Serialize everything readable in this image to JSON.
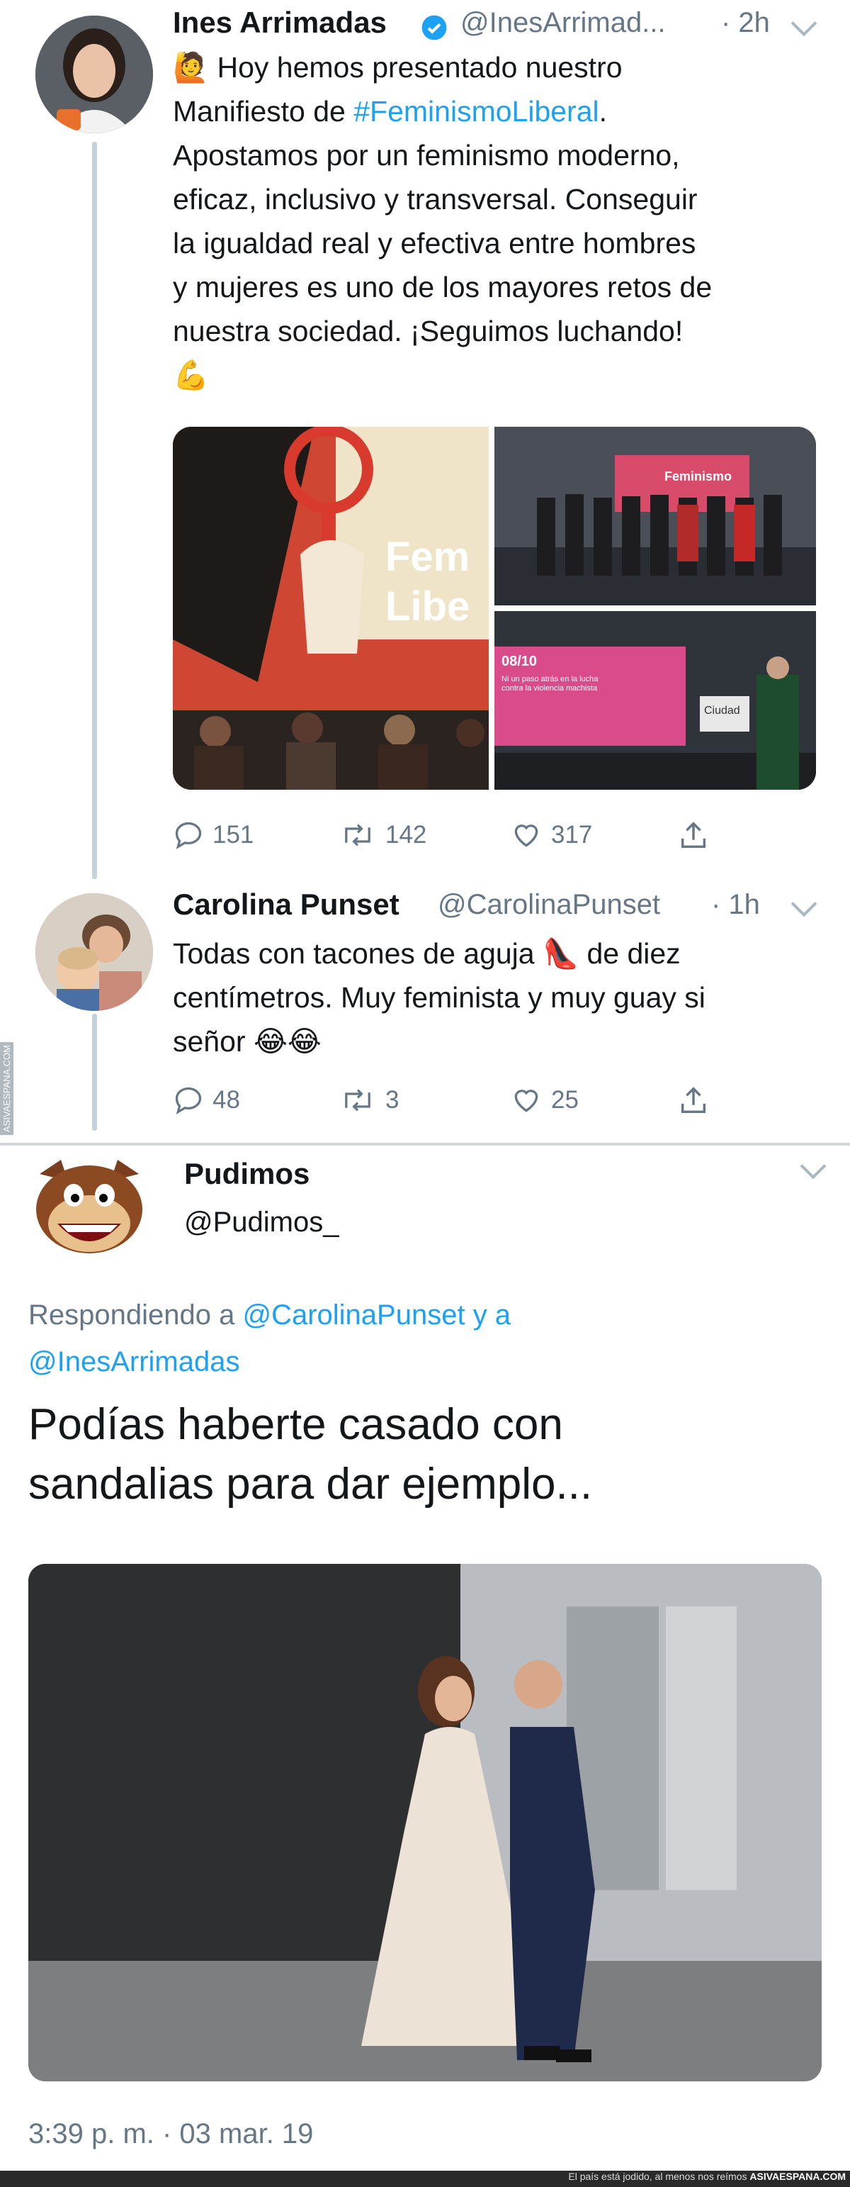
{
  "tweet1": {
    "name": "Ines Arrimadas",
    "handle": "@InesArrimad...",
    "time": "· 2h",
    "emoji_start": "🙋",
    "text_line1": "Hoy hemos presentado nuestro",
    "text_line2_pre": "Manifiesto de ",
    "hashtag": "#FeminismoLiberal",
    "text_line2_post": ".",
    "text_line3": "Apostamos por un feminismo moderno,",
    "text_line4": "eficaz, inclusivo y transversal. Conseguir",
    "text_line5": "la igualdad real y efectiva entre hombres",
    "text_line6": "y mujeres es uno de los mayores retos de",
    "text_line7": "nuestra sociedad. ¡Seguimos luchando!",
    "emoji_end": "💪",
    "img_banner_text1": "Fem",
    "img_banner_text2": "Libe",
    "img_side_text1": "Feminismo",
    "img_side_text2": "08/10",
    "img_side_text3": "Ni un paso atrás en la lucha contra la violencia machista",
    "img_side_text4": "Ciudad",
    "replies": "151",
    "retweets": "142",
    "likes": "317"
  },
  "tweet2": {
    "name": "Carolina Punset",
    "handle": "@CarolinaPunset",
    "time": "· 1h",
    "text_line1_pre": "Todas con tacones de aguja ",
    "heel_emoji": "👠",
    "text_line1_post": " de diez",
    "text_line2": "centímetros. Muy feminista y muy guay si",
    "text_line3": "señor ",
    "laugh_emoji": "😂😂",
    "replies": "48",
    "retweets": "3",
    "likes": "25"
  },
  "tweet3": {
    "name": "Pudimos",
    "handle": "@Pudimos_",
    "replying_prefix": "Respondiendo a ",
    "replying_user1": "@CarolinaPunset",
    "replying_and": " y a",
    "replying_user2": "@InesArrimadas",
    "text_line1": "Podías haberte casado con",
    "text_line2": "sandalias para dar ejemplo...",
    "timestamp": "3:39 p. m. · 03 mar. 19"
  },
  "watermark": "ASIVAESPANA.COM",
  "footer": {
    "caption": "El país está jodido, al menos nos reímos ",
    "site": "ASIVAESPANA.COM"
  },
  "colors": {
    "link": "#1da1f2",
    "muted": "#657786",
    "verified": "#1da1f2",
    "thread": "#c6d2da"
  }
}
